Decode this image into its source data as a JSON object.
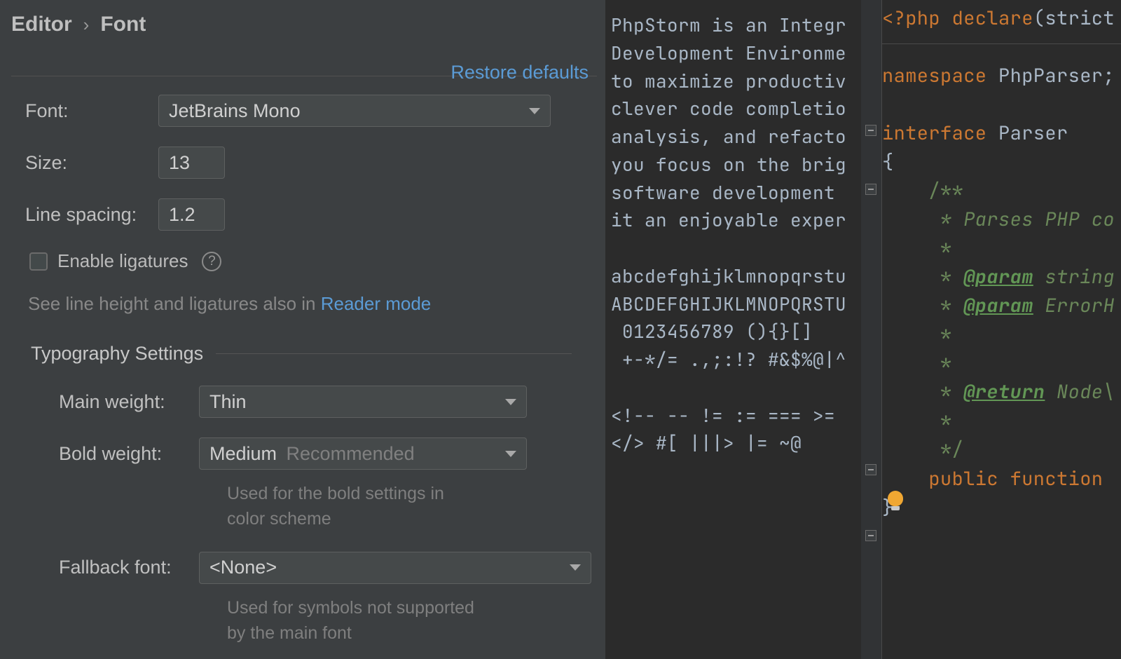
{
  "breadcrumb": {
    "parent": "Editor",
    "chev": "›",
    "current": "Font"
  },
  "restore_defaults": "Restore defaults",
  "form": {
    "font_label": "Font:",
    "font_value": "JetBrains Mono",
    "size_label": "Size:",
    "size_value": "13",
    "linespacing_label": "Line spacing:",
    "linespacing_value": "1.2",
    "enable_ligatures": "Enable ligatures",
    "hint_prefix": "See line height and ligatures also in ",
    "hint_link": "Reader mode"
  },
  "typography": {
    "title": "Typography Settings",
    "main_weight_label": "Main weight:",
    "main_weight_value": "Thin",
    "bold_weight_label": "Bold weight:",
    "bold_weight_value": "Medium",
    "bold_weight_recommended": "Recommended",
    "bold_hint": "Used for the bold settings in color scheme",
    "fallback_label": "Fallback font:",
    "fallback_value": "<None>",
    "fallback_hint": "Used for symbols not supported by the main font"
  },
  "preview": {
    "text": "PhpStorm is an Integr\nDevelopment Environme\nto maximize productiv\nclever code completio\nanalysis, and refacto\nyou focus on the brig\nsoftware development \nit an enjoyable exper\n\nabcdefghijklmnopqrstu\nABCDEFGHIJKLMNOPQRSTU\n 0123456789 (){}[]\n +-*/= .,;:!? #&$%@|^\n\n<!-- -- != := === >=\n</> #[ |||> |= ~@"
  },
  "code": {
    "l1_a": "<?php",
    "l1_b": " declare",
    "l1_c": "(strict",
    "l3": "namespace ",
    "l3b": "PhpParser;",
    "l5a": "interface ",
    "l5b": "Parser",
    "l6": "{",
    "l7": "    /**",
    "l8": "     * Parses PHP co",
    "l9": "     *",
    "l10a": "     * ",
    "l10t": "@param",
    "l10b": " string",
    "l11a": "     * ",
    "l11t": "@param",
    "l11b": " ErrorH",
    "l12": "     *",
    "l13": "     *",
    "l14a": "     * ",
    "l14t": "@return",
    "l14b": " Node\\",
    "l15": "     *",
    "l16": "     */",
    "l17a": "    public function ",
    "l18": "}"
  }
}
